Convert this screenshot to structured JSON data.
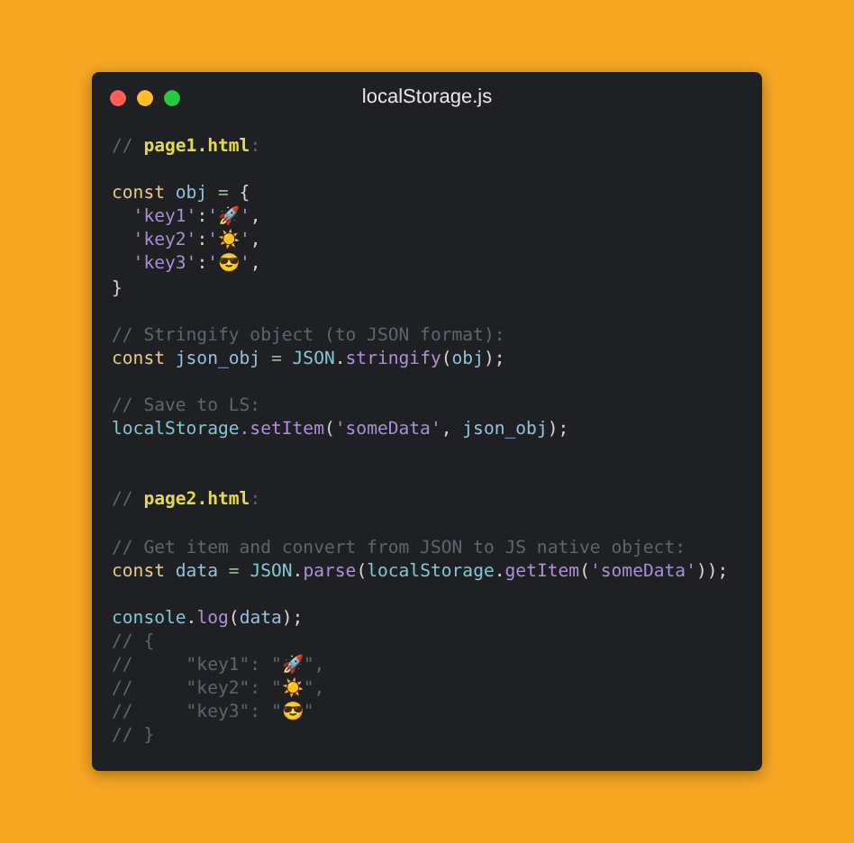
{
  "window": {
    "title": "localStorage.js"
  },
  "code": {
    "lines": [
      {
        "kind": "code",
        "tokens": [
          {
            "kind": "comment",
            "text": "// "
          },
          {
            "kind": "file",
            "text": "page1.html"
          },
          {
            "kind": "comment",
            "text": ":"
          }
        ]
      },
      {
        "kind": "blank"
      },
      {
        "kind": "code",
        "tokens": [
          {
            "kind": "keyword",
            "text": "const "
          },
          {
            "kind": "name",
            "text": "obj"
          },
          {
            "kind": "operator",
            "text": " = "
          },
          {
            "kind": "punct",
            "text": "{"
          }
        ]
      },
      {
        "kind": "code",
        "tokens": [
          {
            "kind": "string",
            "text": "  'key1'"
          },
          {
            "kind": "punct",
            "text": ":"
          },
          {
            "kind": "string",
            "text": "'🚀'"
          },
          {
            "kind": "punct",
            "text": ","
          }
        ]
      },
      {
        "kind": "code",
        "tokens": [
          {
            "kind": "string",
            "text": "  'key2'"
          },
          {
            "kind": "punct",
            "text": ":"
          },
          {
            "kind": "string",
            "text": "'☀️'"
          },
          {
            "kind": "punct",
            "text": ","
          }
        ]
      },
      {
        "kind": "code",
        "tokens": [
          {
            "kind": "string",
            "text": "  'key3'"
          },
          {
            "kind": "punct",
            "text": ":"
          },
          {
            "kind": "string",
            "text": "'😎'"
          },
          {
            "kind": "punct",
            "text": ","
          }
        ]
      },
      {
        "kind": "code",
        "tokens": [
          {
            "kind": "punct",
            "text": "}"
          }
        ]
      },
      {
        "kind": "blank"
      },
      {
        "kind": "code",
        "tokens": [
          {
            "kind": "comment",
            "text": "// Stringify object (to JSON format):"
          }
        ]
      },
      {
        "kind": "code",
        "tokens": [
          {
            "kind": "keyword",
            "text": "const "
          },
          {
            "kind": "name",
            "text": "json_obj"
          },
          {
            "kind": "operator",
            "text": " = "
          },
          {
            "kind": "object",
            "text": "JSON"
          },
          {
            "kind": "punct",
            "text": "."
          },
          {
            "kind": "method",
            "text": "stringify"
          },
          {
            "kind": "punct",
            "text": "("
          },
          {
            "kind": "name",
            "text": "obj"
          },
          {
            "kind": "punct",
            "text": ");"
          }
        ]
      },
      {
        "kind": "blank"
      },
      {
        "kind": "code",
        "tokens": [
          {
            "kind": "comment",
            "text": "// Save to LS:"
          }
        ]
      },
      {
        "kind": "code",
        "tokens": [
          {
            "kind": "object",
            "text": "localStorage"
          },
          {
            "kind": "method",
            "text": ".setItem"
          },
          {
            "kind": "punct",
            "text": "("
          },
          {
            "kind": "string",
            "text": "'someData'"
          },
          {
            "kind": "punct",
            "text": ", "
          },
          {
            "kind": "name",
            "text": "json_obj"
          },
          {
            "kind": "punct",
            "text": ");"
          }
        ]
      },
      {
        "kind": "blank"
      },
      {
        "kind": "blank"
      },
      {
        "kind": "code",
        "tokens": [
          {
            "kind": "comment",
            "text": "// "
          },
          {
            "kind": "file",
            "text": "page2.html"
          },
          {
            "kind": "comment",
            "text": ":"
          }
        ]
      },
      {
        "kind": "blank"
      },
      {
        "kind": "code",
        "tokens": [
          {
            "kind": "comment",
            "text": "// Get item and convert from JSON to JS native object:"
          }
        ]
      },
      {
        "kind": "code",
        "tokens": [
          {
            "kind": "keyword",
            "text": "const "
          },
          {
            "kind": "name",
            "text": "data"
          },
          {
            "kind": "operator",
            "text": " = "
          },
          {
            "kind": "object",
            "text": "JSON"
          },
          {
            "kind": "punct",
            "text": "."
          },
          {
            "kind": "method",
            "text": "parse"
          },
          {
            "kind": "punct",
            "text": "("
          },
          {
            "kind": "object",
            "text": "localStorage"
          },
          {
            "kind": "punct",
            "text": "."
          },
          {
            "kind": "method",
            "text": "getItem"
          },
          {
            "kind": "punct",
            "text": "("
          },
          {
            "kind": "string",
            "text": "'someData'"
          },
          {
            "kind": "punct",
            "text": "));"
          }
        ]
      },
      {
        "kind": "blank"
      },
      {
        "kind": "code",
        "tokens": [
          {
            "kind": "object",
            "text": "console"
          },
          {
            "kind": "punct",
            "text": "."
          },
          {
            "kind": "method",
            "text": "log"
          },
          {
            "kind": "punct",
            "text": "("
          },
          {
            "kind": "name",
            "text": "data"
          },
          {
            "kind": "punct",
            "text": ");"
          }
        ]
      },
      {
        "kind": "code",
        "tokens": [
          {
            "kind": "comment",
            "text": "// {"
          }
        ]
      },
      {
        "kind": "code",
        "tokens": [
          {
            "kind": "comment",
            "text": "//     \"key1\": \"🚀\","
          }
        ]
      },
      {
        "kind": "code",
        "tokens": [
          {
            "kind": "comment",
            "text": "//     \"key2\": \"☀️\","
          }
        ]
      },
      {
        "kind": "code",
        "tokens": [
          {
            "kind": "comment",
            "text": "//     \"key3\": \"😎\""
          }
        ]
      },
      {
        "kind": "code",
        "tokens": [
          {
            "kind": "comment",
            "text": "// }"
          }
        ]
      }
    ]
  }
}
